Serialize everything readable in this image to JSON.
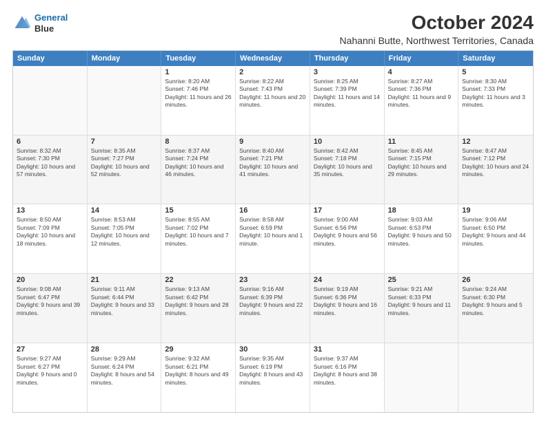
{
  "logo": {
    "line1": "General",
    "line2": "Blue"
  },
  "title": "October 2024",
  "subtitle": "Nahanni Butte, Northwest Territories, Canada",
  "days_of_week": [
    "Sunday",
    "Monday",
    "Tuesday",
    "Wednesday",
    "Thursday",
    "Friday",
    "Saturday"
  ],
  "weeks": [
    [
      {
        "day": "",
        "info": ""
      },
      {
        "day": "",
        "info": ""
      },
      {
        "day": "1",
        "info": "Sunrise: 8:20 AM\nSunset: 7:46 PM\nDaylight: 11 hours and 26 minutes."
      },
      {
        "day": "2",
        "info": "Sunrise: 8:22 AM\nSunset: 7:43 PM\nDaylight: 11 hours and 20 minutes."
      },
      {
        "day": "3",
        "info": "Sunrise: 8:25 AM\nSunset: 7:39 PM\nDaylight: 11 hours and 14 minutes."
      },
      {
        "day": "4",
        "info": "Sunrise: 8:27 AM\nSunset: 7:36 PM\nDaylight: 11 hours and 9 minutes."
      },
      {
        "day": "5",
        "info": "Sunrise: 8:30 AM\nSunset: 7:33 PM\nDaylight: 11 hours and 3 minutes."
      }
    ],
    [
      {
        "day": "6",
        "info": "Sunrise: 8:32 AM\nSunset: 7:30 PM\nDaylight: 10 hours and 57 minutes."
      },
      {
        "day": "7",
        "info": "Sunrise: 8:35 AM\nSunset: 7:27 PM\nDaylight: 10 hours and 52 minutes."
      },
      {
        "day": "8",
        "info": "Sunrise: 8:37 AM\nSunset: 7:24 PM\nDaylight: 10 hours and 46 minutes."
      },
      {
        "day": "9",
        "info": "Sunrise: 8:40 AM\nSunset: 7:21 PM\nDaylight: 10 hours and 41 minutes."
      },
      {
        "day": "10",
        "info": "Sunrise: 8:42 AM\nSunset: 7:18 PM\nDaylight: 10 hours and 35 minutes."
      },
      {
        "day": "11",
        "info": "Sunrise: 8:45 AM\nSunset: 7:15 PM\nDaylight: 10 hours and 29 minutes."
      },
      {
        "day": "12",
        "info": "Sunrise: 8:47 AM\nSunset: 7:12 PM\nDaylight: 10 hours and 24 minutes."
      }
    ],
    [
      {
        "day": "13",
        "info": "Sunrise: 8:50 AM\nSunset: 7:09 PM\nDaylight: 10 hours and 18 minutes."
      },
      {
        "day": "14",
        "info": "Sunrise: 8:53 AM\nSunset: 7:05 PM\nDaylight: 10 hours and 12 minutes."
      },
      {
        "day": "15",
        "info": "Sunrise: 8:55 AM\nSunset: 7:02 PM\nDaylight: 10 hours and 7 minutes."
      },
      {
        "day": "16",
        "info": "Sunrise: 8:58 AM\nSunset: 6:59 PM\nDaylight: 10 hours and 1 minute."
      },
      {
        "day": "17",
        "info": "Sunrise: 9:00 AM\nSunset: 6:56 PM\nDaylight: 9 hours and 56 minutes."
      },
      {
        "day": "18",
        "info": "Sunrise: 9:03 AM\nSunset: 6:53 PM\nDaylight: 9 hours and 50 minutes."
      },
      {
        "day": "19",
        "info": "Sunrise: 9:06 AM\nSunset: 6:50 PM\nDaylight: 9 hours and 44 minutes."
      }
    ],
    [
      {
        "day": "20",
        "info": "Sunrise: 9:08 AM\nSunset: 6:47 PM\nDaylight: 9 hours and 39 minutes."
      },
      {
        "day": "21",
        "info": "Sunrise: 9:11 AM\nSunset: 6:44 PM\nDaylight: 9 hours and 33 minutes."
      },
      {
        "day": "22",
        "info": "Sunrise: 9:13 AM\nSunset: 6:42 PM\nDaylight: 9 hours and 28 minutes."
      },
      {
        "day": "23",
        "info": "Sunrise: 9:16 AM\nSunset: 6:39 PM\nDaylight: 9 hours and 22 minutes."
      },
      {
        "day": "24",
        "info": "Sunrise: 9:19 AM\nSunset: 6:36 PM\nDaylight: 9 hours and 16 minutes."
      },
      {
        "day": "25",
        "info": "Sunrise: 9:21 AM\nSunset: 6:33 PM\nDaylight: 9 hours and 11 minutes."
      },
      {
        "day": "26",
        "info": "Sunrise: 9:24 AM\nSunset: 6:30 PM\nDaylight: 9 hours and 5 minutes."
      }
    ],
    [
      {
        "day": "27",
        "info": "Sunrise: 9:27 AM\nSunset: 6:27 PM\nDaylight: 9 hours and 0 minutes."
      },
      {
        "day": "28",
        "info": "Sunrise: 9:29 AM\nSunset: 6:24 PM\nDaylight: 8 hours and 54 minutes."
      },
      {
        "day": "29",
        "info": "Sunrise: 9:32 AM\nSunset: 6:21 PM\nDaylight: 8 hours and 49 minutes."
      },
      {
        "day": "30",
        "info": "Sunrise: 9:35 AM\nSunset: 6:19 PM\nDaylight: 8 hours and 43 minutes."
      },
      {
        "day": "31",
        "info": "Sunrise: 9:37 AM\nSunset: 6:16 PM\nDaylight: 8 hours and 38 minutes."
      },
      {
        "day": "",
        "info": ""
      },
      {
        "day": "",
        "info": ""
      }
    ]
  ]
}
